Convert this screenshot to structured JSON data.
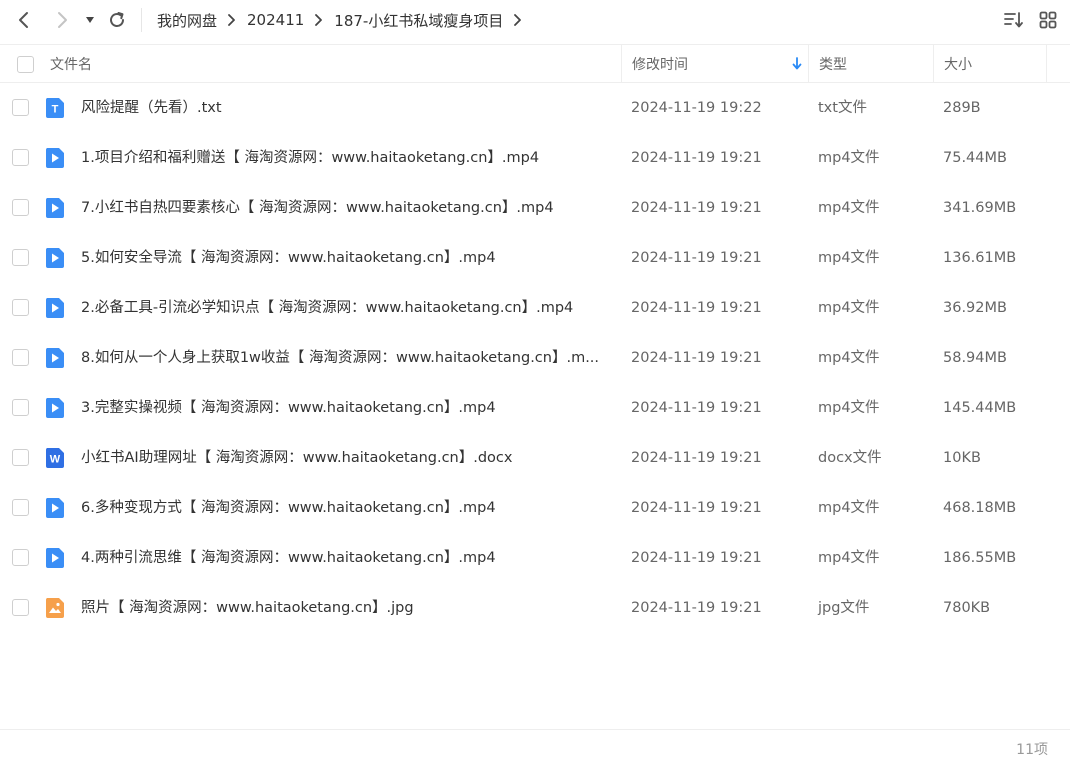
{
  "breadcrumb": [
    "我的网盘",
    "202411",
    "187-小红书私域瘦身项目"
  ],
  "columns": {
    "name": "文件名",
    "time": "修改时间",
    "type": "类型",
    "size": "大小"
  },
  "colors": {
    "video": "#3a8ef6",
    "txt": "#3a8ef6",
    "docx": "#2f6fe4",
    "jpg": "#f6a04b"
  },
  "files": [
    {
      "name": "风险提醒（先看）.txt",
      "time": "2024-11-19 19:22",
      "type": "txt文件",
      "size": "289B",
      "icon": "txt-file-icon",
      "glyph": "T",
      "kind": "txt"
    },
    {
      "name": "1.项目介绍和福利赠送【 海淘资源网：www.haitaoketang.cn】.mp4",
      "time": "2024-11-19 19:21",
      "type": "mp4文件",
      "size": "75.44MB",
      "icon": "video-file-icon",
      "glyph": "",
      "kind": "video"
    },
    {
      "name": "7.小红书自热四要素核心【 海淘资源网：www.haitaoketang.cn】.mp4",
      "time": "2024-11-19 19:21",
      "type": "mp4文件",
      "size": "341.69MB",
      "icon": "video-file-icon",
      "glyph": "",
      "kind": "video"
    },
    {
      "name": "5.如何安全导流【 海淘资源网：www.haitaoketang.cn】.mp4",
      "time": "2024-11-19 19:21",
      "type": "mp4文件",
      "size": "136.61MB",
      "icon": "video-file-icon",
      "glyph": "",
      "kind": "video"
    },
    {
      "name": "2.必备工具-引流必学知识点【 海淘资源网：www.haitaoketang.cn】.mp4",
      "time": "2024-11-19 19:21",
      "type": "mp4文件",
      "size": "36.92MB",
      "icon": "video-file-icon",
      "glyph": "",
      "kind": "video"
    },
    {
      "name": "8.如何从一个人身上获取1w收益【 海淘资源网：www.haitaoketang.cn】.m...",
      "time": "2024-11-19 19:21",
      "type": "mp4文件",
      "size": "58.94MB",
      "icon": "video-file-icon",
      "glyph": "",
      "kind": "video"
    },
    {
      "name": "3.完整实操视频【 海淘资源网：www.haitaoketang.cn】.mp4",
      "time": "2024-11-19 19:21",
      "type": "mp4文件",
      "size": "145.44MB",
      "icon": "video-file-icon",
      "glyph": "",
      "kind": "video"
    },
    {
      "name": "小红书AI助理网址【 海淘资源网：www.haitaoketang.cn】.docx",
      "time": "2024-11-19 19:21",
      "type": "docx文件",
      "size": "10KB",
      "icon": "word-file-icon",
      "glyph": "W",
      "kind": "docx"
    },
    {
      "name": "6.多种变现方式【 海淘资源网：www.haitaoketang.cn】.mp4",
      "time": "2024-11-19 19:21",
      "type": "mp4文件",
      "size": "468.18MB",
      "icon": "video-file-icon",
      "glyph": "",
      "kind": "video"
    },
    {
      "name": "4.两种引流思维【 海淘资源网：www.haitaoketang.cn】.mp4",
      "time": "2024-11-19 19:21",
      "type": "mp4文件",
      "size": "186.55MB",
      "icon": "video-file-icon",
      "glyph": "",
      "kind": "video"
    },
    {
      "name": "照片【 海淘资源网：www.haitaoketang.cn】.jpg",
      "time": "2024-11-19 19:21",
      "type": "jpg文件",
      "size": "780KB",
      "icon": "image-file-icon",
      "glyph": "",
      "kind": "jpg"
    }
  ],
  "footer": {
    "count": "11项"
  }
}
